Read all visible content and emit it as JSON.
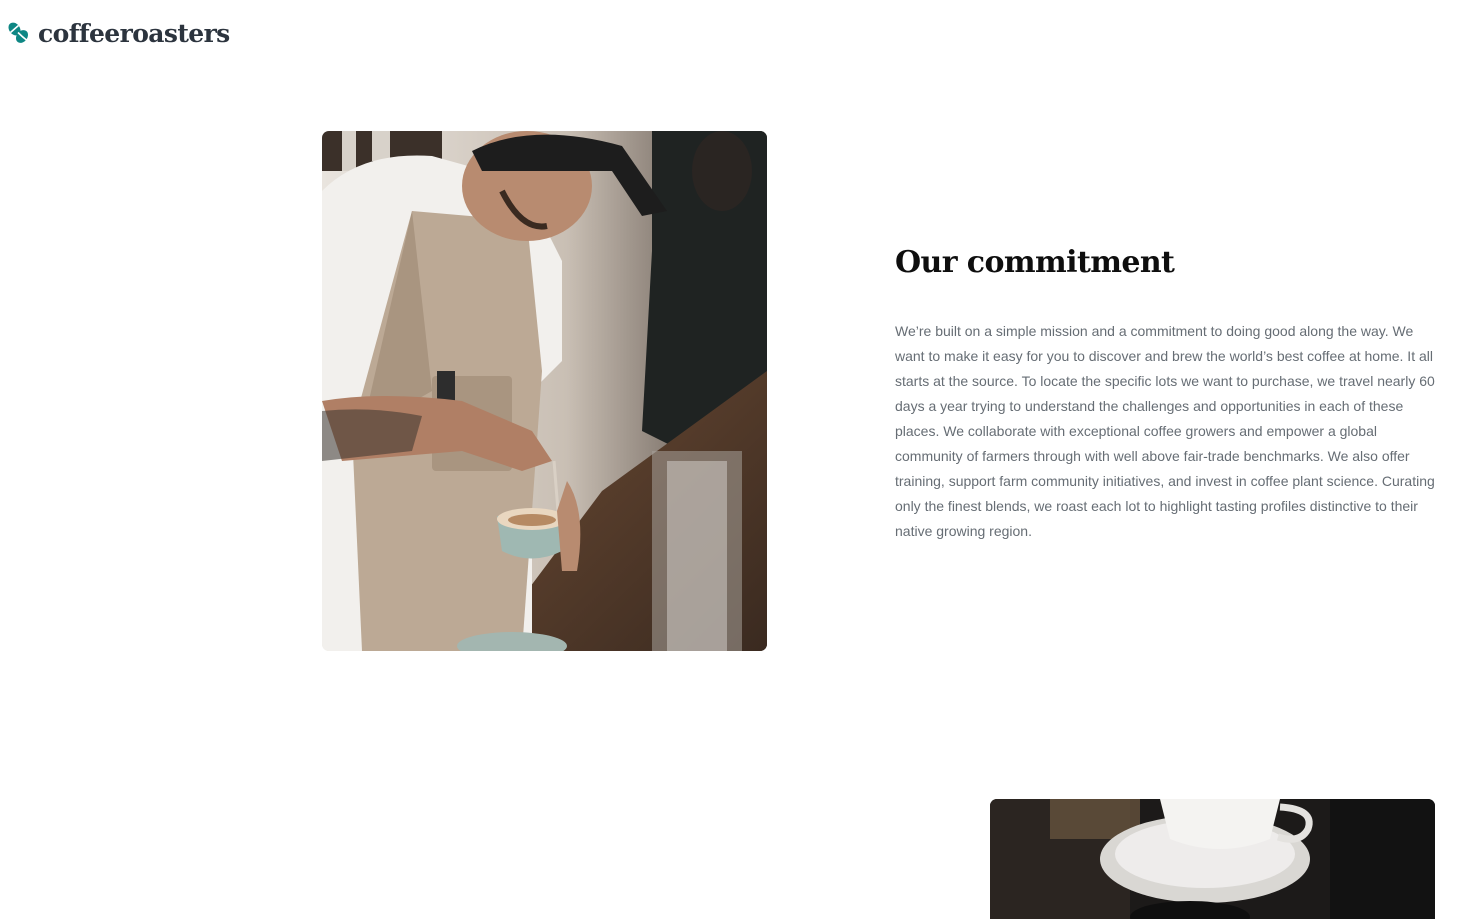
{
  "brand": {
    "name": "coffeeroasters",
    "icon": "coffee-beans-icon",
    "color": "#2c343e",
    "accent": "#0e8784"
  },
  "commitment": {
    "heading": "Our commitment",
    "body": "We’re built on a simple mission and a commitment to doing good along the way. We want to make it easy for you to discover and brew the world’s best coffee at home. It all starts at the source. To locate the specific lots we want to purchase, we travel nearly 60 days a year trying to understand the challenges and opportunities in each of these places. We collaborate with exceptional coffee growers and empower a global community of farmers through with well above fair-trade benchmarks. We also offer training, support farm community initiatives, and invest in coffee plant science. Curating only the finest blends, we roast each lot to highlight tasting profiles distinctive to their native growing region."
  },
  "colors": {
    "heading": "#0e0e0e",
    "body_text": "#666d74",
    "background": "#ffffff"
  }
}
